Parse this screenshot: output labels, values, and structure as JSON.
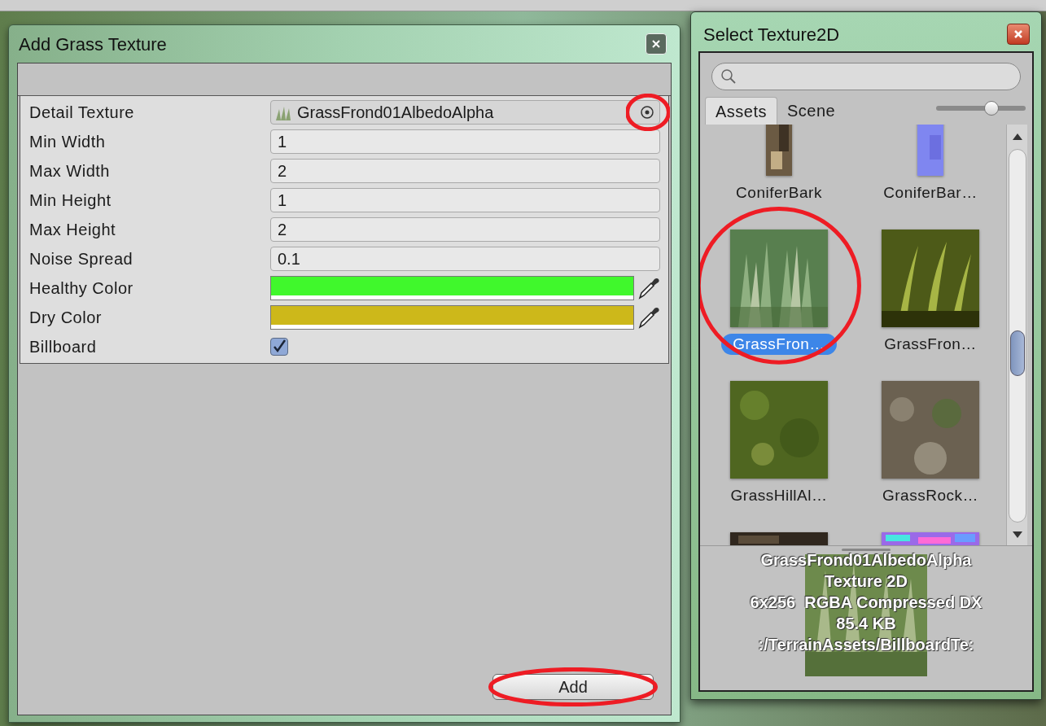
{
  "grass_dialog": {
    "title": "Add Grass Texture",
    "properties": [
      {
        "kind": "object",
        "label": "Detail Texture",
        "value": "GrassFrond01AlbedoAlpha",
        "circled": true
      },
      {
        "kind": "number",
        "label": "Min Width",
        "value": "1"
      },
      {
        "kind": "number",
        "label": "Max Width",
        "value": "2"
      },
      {
        "kind": "number",
        "label": "Min Height",
        "value": "1"
      },
      {
        "kind": "number",
        "label": "Max Height",
        "value": "2"
      },
      {
        "kind": "number",
        "label": "Noise Spread",
        "value": "0.1"
      },
      {
        "kind": "color",
        "label": "Healthy Color",
        "color": "#40f82c"
      },
      {
        "kind": "color",
        "label": "Dry Color",
        "color": "#cdb81a"
      },
      {
        "kind": "toggle",
        "label": "Billboard",
        "checked": true
      }
    ],
    "add_button": {
      "label": "Add",
      "circled": true
    }
  },
  "texture_picker": {
    "title": "Select Texture2D",
    "tabs": [
      {
        "label": "Assets",
        "selected": true
      },
      {
        "label": "Scene",
        "selected": false
      }
    ],
    "zoom_slider": {
      "level": 0.62
    },
    "assets": [
      {
        "name": "ConiferBark",
        "selected": false,
        "circled": false
      },
      {
        "name": "ConiferBar…",
        "selected": false,
        "circled": false
      },
      {
        "name": "GrassFron…",
        "selected": true,
        "circled": true
      },
      {
        "name": "GrassFron…",
        "selected": false,
        "circled": false
      },
      {
        "name": "GrassHillAl…",
        "selected": false,
        "circled": false
      },
      {
        "name": "GrassRock…",
        "selected": false,
        "circled": false
      },
      {
        "kind": "picture"
      },
      {
        "kind": "picture"
      }
    ],
    "preview": {
      "lines": [
        "GrassFrond01AlbedoAlpha",
        "Texture 2D",
        "6x256  RGBA Compressed DX",
        "85.4 KB",
        ":/TerrainAssets/BillboardTe:"
      ]
    }
  }
}
